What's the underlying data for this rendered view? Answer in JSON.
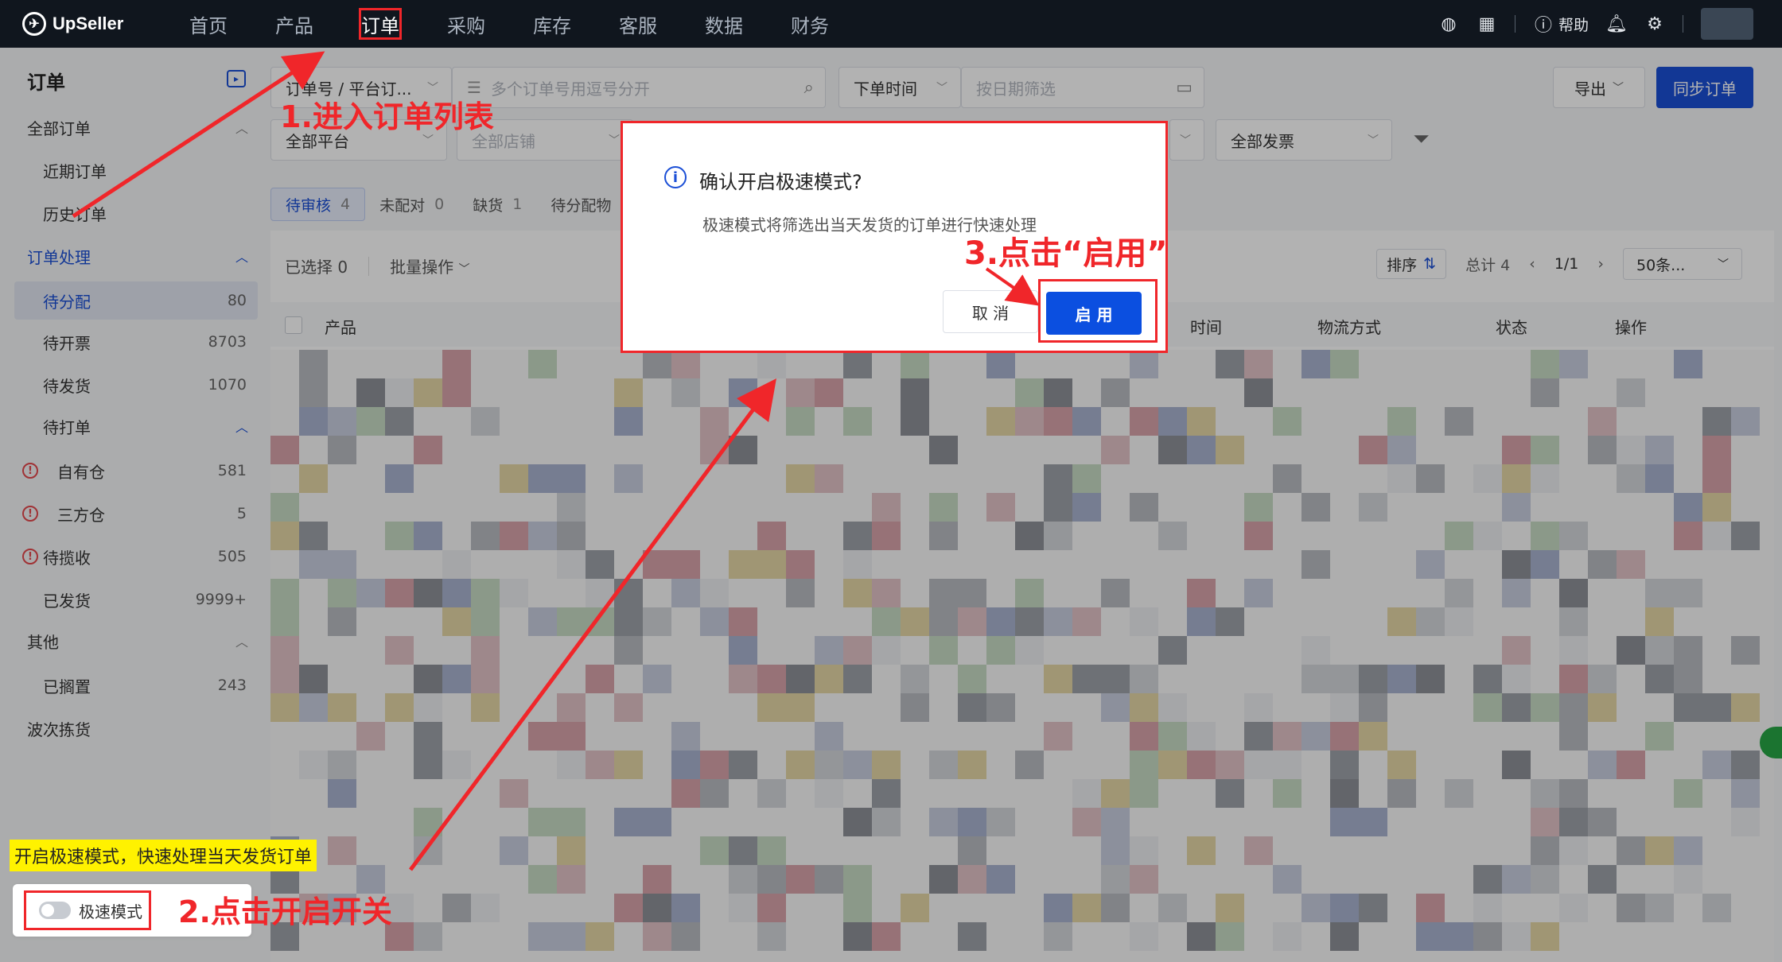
{
  "app": {
    "logo_text": "UpSeller",
    "nav": [
      "首页",
      "产品",
      "订单",
      "采购",
      "库存",
      "客服",
      "数据",
      "财务"
    ],
    "nav_active_index": 2,
    "help_label": "帮助"
  },
  "sidebar": {
    "title": "订单",
    "all_orders": "全部订单",
    "recent_orders": "近期订单",
    "history_orders": "历史订单",
    "processing": "订单处理",
    "pending_assign": {
      "label": "待分配",
      "count": "80"
    },
    "pending_invoice": {
      "label": "待开票",
      "count": "8703"
    },
    "pending_ship": {
      "label": "待发货",
      "count": "1070"
    },
    "pending_print": "待打单",
    "own_warehouse": {
      "label": "自有仓",
      "count": "581"
    },
    "third_warehouse": {
      "label": "三方仓",
      "count": "5"
    },
    "pending_pickup": {
      "label": "待揽收",
      "count": "505"
    },
    "shipped": {
      "label": "已发货",
      "count": "9999+"
    },
    "other": "其他",
    "shelved": {
      "label": "已搁置",
      "count": "243"
    },
    "wave_picking": "波次拣货",
    "speed_tip": "开启极速模式，快速处理当天发货订单",
    "speed_mode_label": "极速模式"
  },
  "filters": {
    "order_no_select": "订单号 / 平台订...",
    "order_no_placeholder": "多个订单号用逗号分开",
    "time_select": "下单时间",
    "date_placeholder": "按日期筛选",
    "platform_select": "全部平台",
    "shop_select": "全部店铺",
    "invoice_select": "全部发票",
    "export_label": "导出",
    "sync_label": "同步订单"
  },
  "tabs": [
    {
      "label": "待审核",
      "count": "4"
    },
    {
      "label": "未配对",
      "count": "0"
    },
    {
      "label": "缺货",
      "count": "1"
    },
    {
      "label": "待分配物",
      "count": ""
    }
  ],
  "table": {
    "selected_label": "已选择 0",
    "batch_label": "批量操作",
    "sort_label": "排序",
    "total_label": "总计 4",
    "page_label": "1/1",
    "page_size_label": "50条...",
    "headers": {
      "product": "产品",
      "time": "时间",
      "shipping": "物流方式",
      "status": "状态",
      "action": "操作"
    }
  },
  "dialog": {
    "title": "确认开启极速模式?",
    "message": "极速模式将筛选出当天发货的订单进行快速处理",
    "cancel_label": "取 消",
    "confirm_label": "启 用"
  },
  "annotations": {
    "step1": "1.进入订单列表",
    "step2": "2.点击开启开关",
    "step3": "3.点击“启用”"
  },
  "colors": {
    "nav_bg": "#10161e",
    "primary": "#1b4fd6",
    "annotation_red": "#f0262a",
    "tip_yellow": "#fff200"
  }
}
